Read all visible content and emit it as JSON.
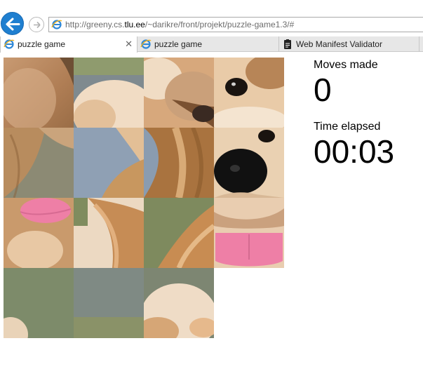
{
  "browser": {
    "url_prefix": "http://greeny.cs.",
    "url_host": "tlu.ee",
    "url_rest": "/~darikre/front/projekt/puzzle-game1.3/#",
    "tabs": [
      {
        "label": "puzzle game",
        "icon": "ie-icon",
        "active": true,
        "closable": true
      },
      {
        "label": "puzzle game",
        "icon": "ie-icon",
        "active": false
      },
      {
        "label": "Web Manifest Validator",
        "icon": "clipboard-icon",
        "active": false
      }
    ]
  },
  "game": {
    "moves_label": "Moves made",
    "moves_value": "0",
    "time_label": "Time elapsed",
    "time_value": "00:03",
    "grid_size": 4,
    "empty_tile": {
      "row": 3,
      "col": 3
    }
  },
  "colors": {
    "back_button": "#1f7fd0",
    "fur_light": "#efd7b8",
    "fur_mid": "#d9a77a",
    "fur_dark": "#a86a3a",
    "bg_blue": "#8b9cae",
    "bg_green": "#7e8a5e",
    "tongue": "#ee7fa6",
    "nose": "#1c1c1c"
  }
}
